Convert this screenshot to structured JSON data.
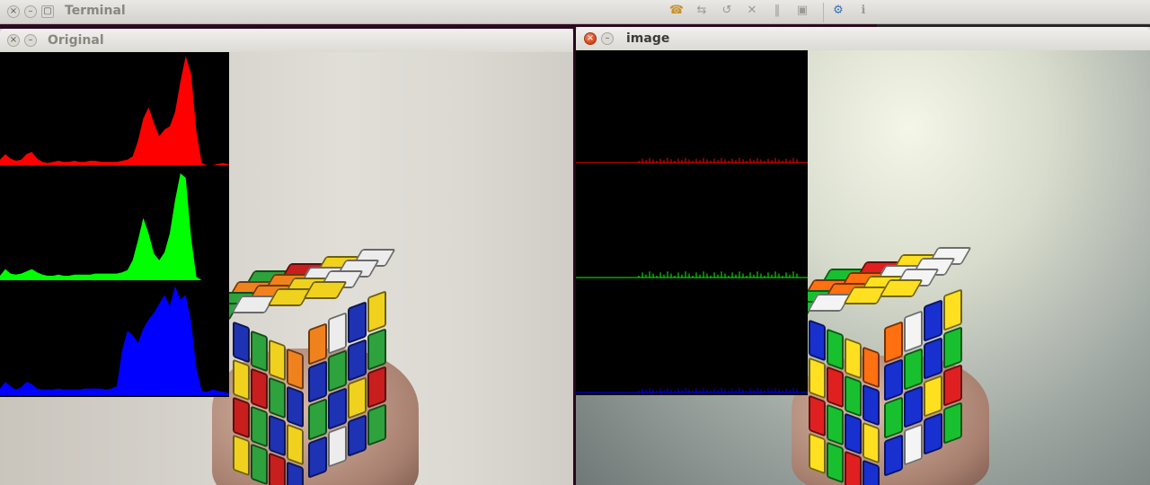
{
  "terminal": {
    "title": "Terminal",
    "toolbar_icons": [
      "phone-icon",
      "transfer-icon",
      "relay-icon",
      "mic-off-icon",
      "pause-icon",
      "stop-icon",
      "settings-icon",
      "info-icon"
    ]
  },
  "original_window": {
    "title": "Original",
    "histogram": {
      "channels": [
        {
          "name": "red",
          "color": "#ff0000",
          "profile": [
            0.05,
            0.1,
            0.06,
            0.04,
            0.05,
            0.1,
            0.12,
            0.06,
            0.03,
            0.02,
            0.03,
            0.04,
            0.03,
            0.03,
            0.04,
            0.03,
            0.03,
            0.04,
            0.04,
            0.03,
            0.03,
            0.03,
            0.03,
            0.04,
            0.05,
            0.08,
            0.22,
            0.42,
            0.52,
            0.38,
            0.26,
            0.32,
            0.35,
            0.48,
            0.75,
            0.98,
            0.82,
            0.3,
            0.02,
            0.0,
            0.0,
            0.01,
            0.02,
            0.01
          ]
        },
        {
          "name": "green",
          "color": "#00ff00",
          "profile": [
            0.04,
            0.1,
            0.06,
            0.05,
            0.06,
            0.08,
            0.1,
            0.07,
            0.05,
            0.04,
            0.04,
            0.05,
            0.04,
            0.04,
            0.05,
            0.05,
            0.05,
            0.05,
            0.06,
            0.06,
            0.06,
            0.06,
            0.06,
            0.07,
            0.09,
            0.18,
            0.36,
            0.56,
            0.42,
            0.24,
            0.18,
            0.25,
            0.42,
            0.72,
            0.96,
            0.92,
            0.38,
            0.03,
            0.0,
            0.0,
            0.0,
            0.0,
            0.0,
            0.0
          ]
        },
        {
          "name": "blue",
          "color": "#0000ff",
          "profile": [
            0.06,
            0.12,
            0.08,
            0.05,
            0.07,
            0.12,
            0.1,
            0.06,
            0.05,
            0.05,
            0.05,
            0.06,
            0.05,
            0.05,
            0.05,
            0.05,
            0.06,
            0.06,
            0.06,
            0.06,
            0.05,
            0.06,
            0.08,
            0.4,
            0.58,
            0.54,
            0.47,
            0.6,
            0.68,
            0.74,
            0.82,
            0.9,
            0.8,
            0.98,
            0.86,
            0.9,
            0.66,
            0.24,
            0.04,
            0.03,
            0.05,
            0.04,
            0.03,
            0.02
          ]
        }
      ]
    }
  },
  "image_window": {
    "title": "image",
    "histogram": {
      "channels": [
        {
          "name": "red",
          "color": "#ff0000",
          "profile": [
            0.02
          ]
        },
        {
          "name": "green",
          "color": "#00ff00",
          "profile": [
            0.03
          ]
        },
        {
          "name": "blue",
          "color": "#0000ff",
          "profile": [
            0.02
          ]
        }
      ]
    }
  }
}
